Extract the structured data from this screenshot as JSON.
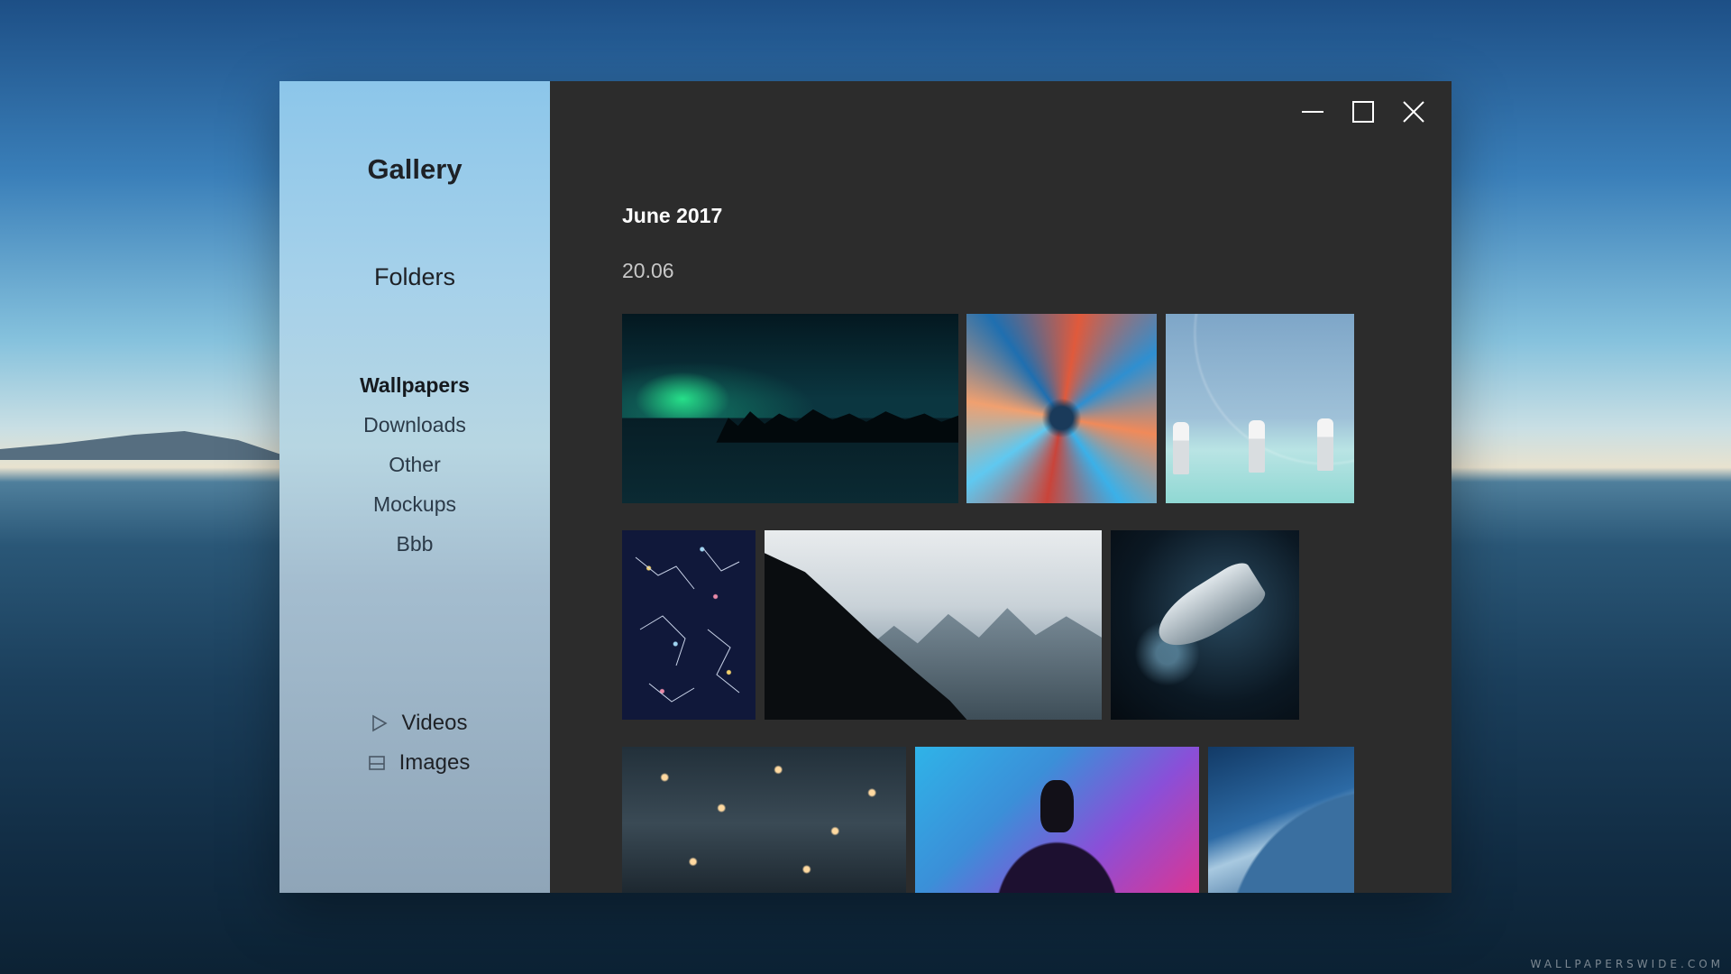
{
  "app": {
    "title": "Gallery"
  },
  "sidebar": {
    "folders_heading": "Folders",
    "folders": [
      {
        "label": "Wallpapers",
        "active": true
      },
      {
        "label": "Downloads",
        "active": false
      },
      {
        "label": "Other",
        "active": false
      },
      {
        "label": "Mockups",
        "active": false
      },
      {
        "label": "Bbb",
        "active": false
      }
    ],
    "media": [
      {
        "label": "Videos",
        "icon": "play-icon"
      },
      {
        "label": "Images",
        "icon": "image-icon"
      }
    ]
  },
  "window_controls": {
    "minimize": "minimize-icon",
    "maximize": "maximize-icon",
    "close": "close-icon"
  },
  "main": {
    "month": "June 2017",
    "day": "20.06",
    "photos": [
      {
        "name": "photo-aurora"
      },
      {
        "name": "photo-color-splash"
      },
      {
        "name": "photo-stormtroopers"
      },
      {
        "name": "photo-constellations"
      },
      {
        "name": "photo-mountain-goat"
      },
      {
        "name": "photo-spaceship"
      },
      {
        "name": "photo-bokeh-lights"
      },
      {
        "name": "photo-neon-figure"
      },
      {
        "name": "photo-earth-orbit"
      }
    ]
  },
  "background": {
    "watermark": "WALLPAPERSWIDE.COM"
  },
  "colors": {
    "main_panel": "#2c2c2c",
    "sidebar_top": "#8cc6ea",
    "sidebar_bottom": "#8fa5b8",
    "text_light": "#ffffff"
  }
}
